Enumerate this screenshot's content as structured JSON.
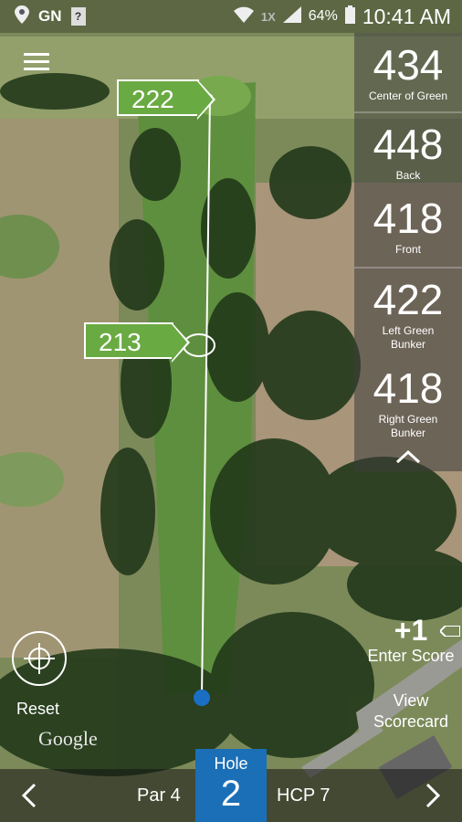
{
  "status_bar": {
    "carrier": "GN",
    "sim_icon_text": "?",
    "network_speed": "1X",
    "battery": "64%",
    "time": "10:41 AM"
  },
  "distances": [
    {
      "value": "434",
      "label": "Center of Green"
    },
    {
      "value": "448",
      "label": "Back"
    },
    {
      "value": "418",
      "label": "Front"
    },
    {
      "value": "422",
      "label": "Left Green Bunker"
    },
    {
      "value": "418",
      "label": "Right Green Bunker"
    }
  ],
  "markers": {
    "target_distance": "222",
    "cursor_distance": "213"
  },
  "controls": {
    "plus_one": "+1",
    "enter_score": "Enter Score",
    "view": "View",
    "scorecard": "Scorecard",
    "reset": "Reset",
    "google": "Google"
  },
  "hole_bar": {
    "par": "Par 4",
    "hole_label": "Hole",
    "hole_number": "2",
    "handicap": "HCP 7"
  },
  "colors": {
    "flag_green": "#6aaa42",
    "hole_blue": "#1b6fb6",
    "ball_blue": "#1a6fc4"
  }
}
